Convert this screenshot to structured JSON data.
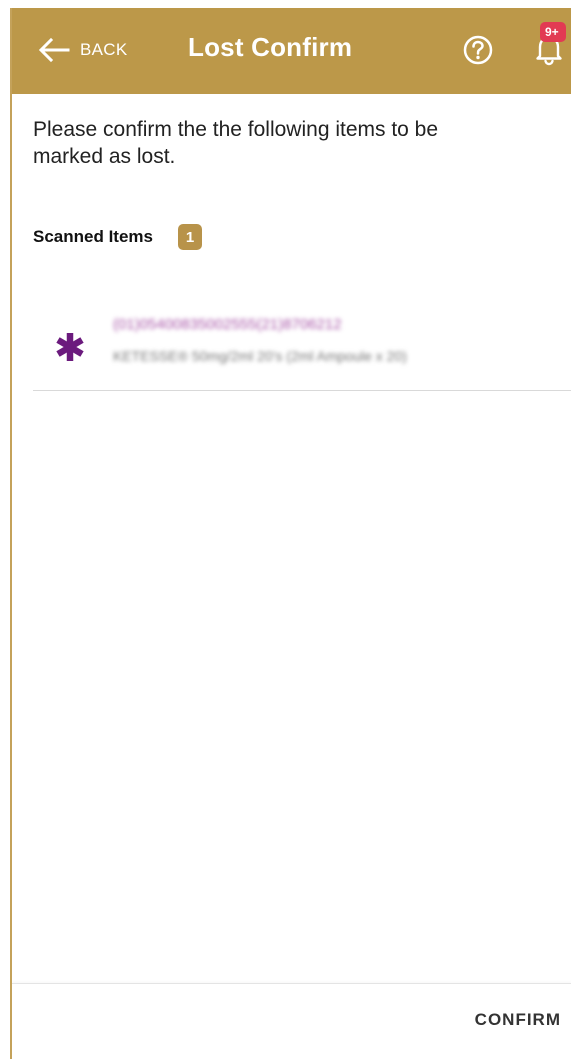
{
  "appbar": {
    "back_label": "BACK",
    "title": "Lost Confirm",
    "notification_badge": "9+",
    "background_color": "#bc9849"
  },
  "content": {
    "instruction": "Please confirm the the following items to be marked as lost.",
    "scanned_label": "Scanned Items",
    "scanned_count": "1"
  },
  "items": [
    {
      "code": "(01)05400835002555(21)8706212",
      "description": "KETESSE® 50mg/2ml 20's (2ml Ampoule x 20)",
      "icon": "asterisk-icon",
      "icon_color": "#6b1a7d"
    }
  ],
  "footer": {
    "confirm_label": "CONFIRM"
  }
}
